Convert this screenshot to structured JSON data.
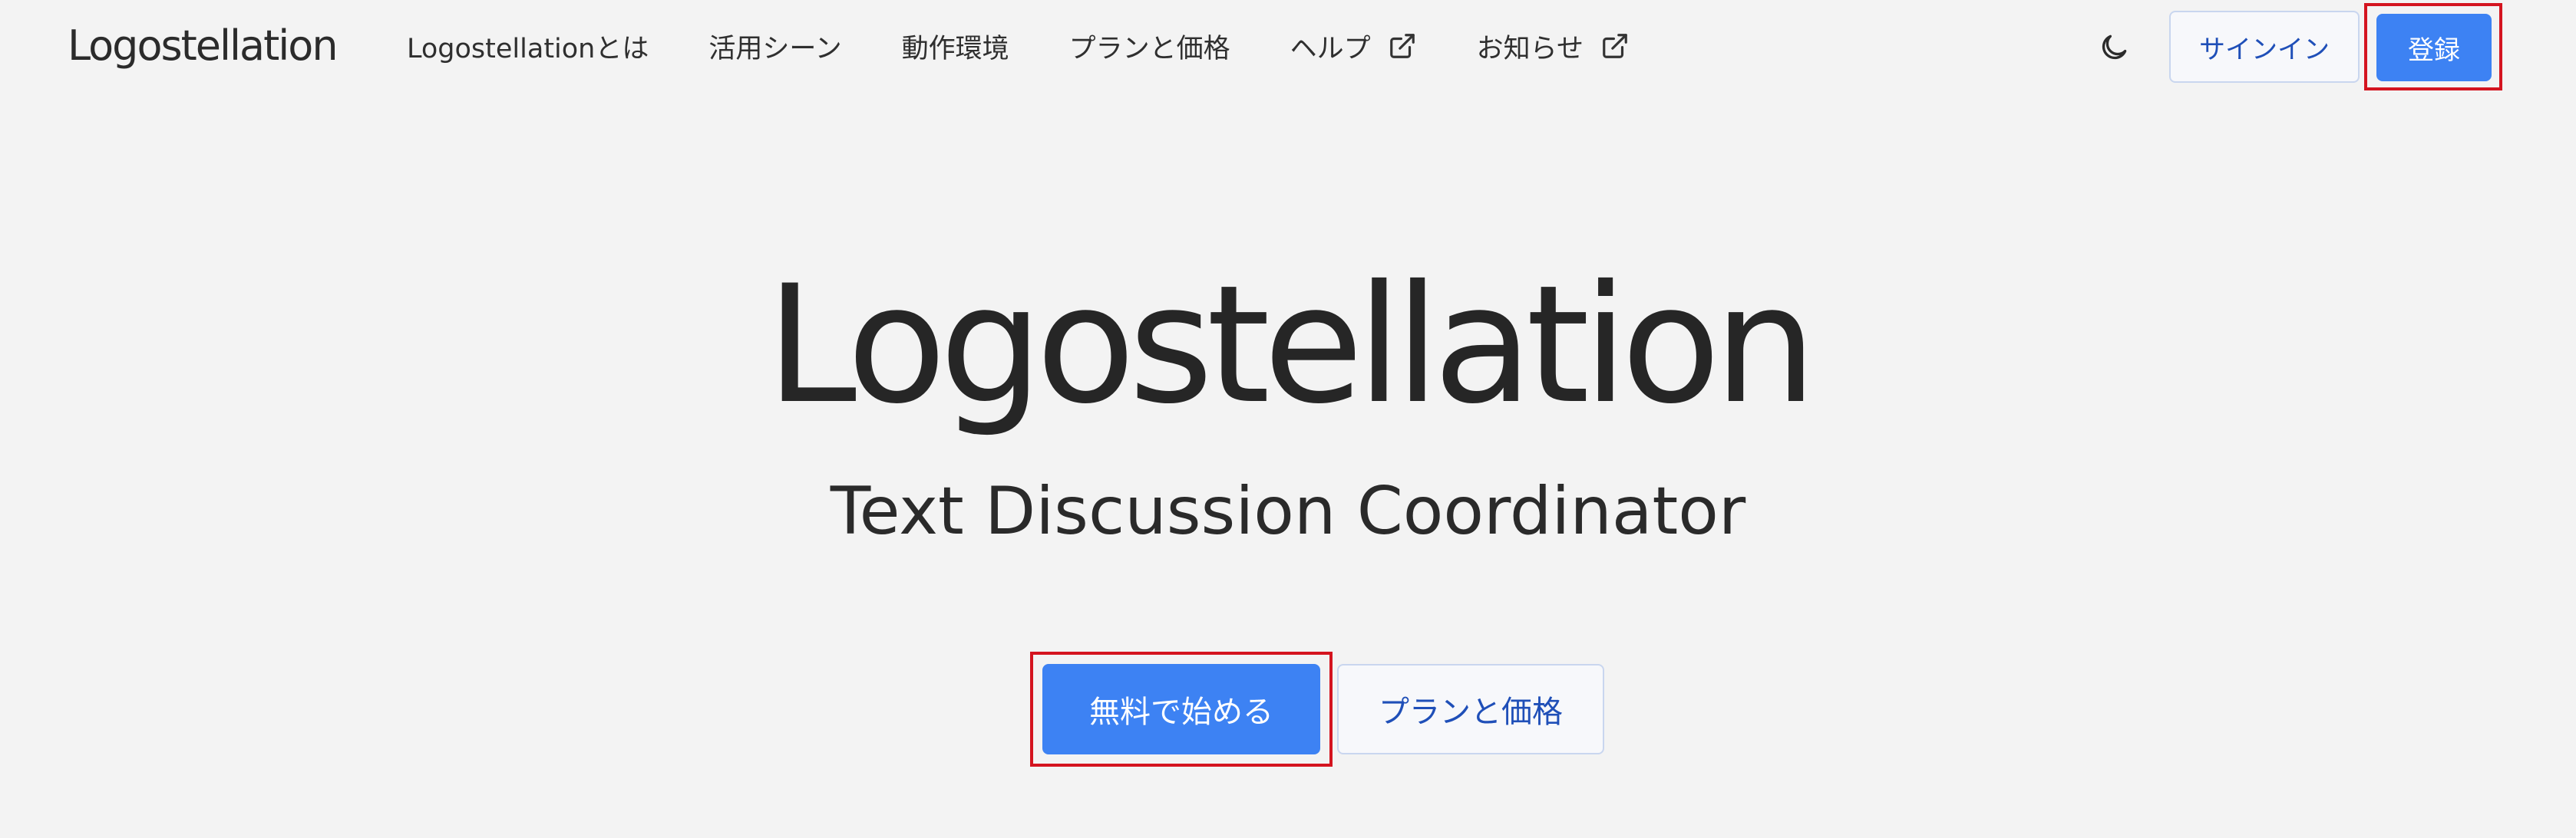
{
  "header": {
    "brand": "Logostellation",
    "nav": [
      {
        "label": "Logostellationとは",
        "external": false
      },
      {
        "label": "活用シーン",
        "external": false
      },
      {
        "label": "動作環境",
        "external": false
      },
      {
        "label": "プランと価格",
        "external": false
      },
      {
        "label": "ヘルプ",
        "external": true,
        "icon": "external-link-icon"
      },
      {
        "label": "お知らせ",
        "external": true,
        "icon": "external-link-icon"
      }
    ],
    "theme_icon": "moon-icon",
    "signin_label": "サインイン",
    "register_label": "登録"
  },
  "hero": {
    "title": "Logostellation",
    "subtitle": "Text Discussion Coordinator",
    "primary_cta": "無料で始める",
    "secondary_cta": "プランと価格"
  },
  "colors": {
    "background": "#f3f3f3",
    "primary": "#3d82f3",
    "outline_text": "#1f4fb8",
    "highlight_box": "#d4141f"
  }
}
